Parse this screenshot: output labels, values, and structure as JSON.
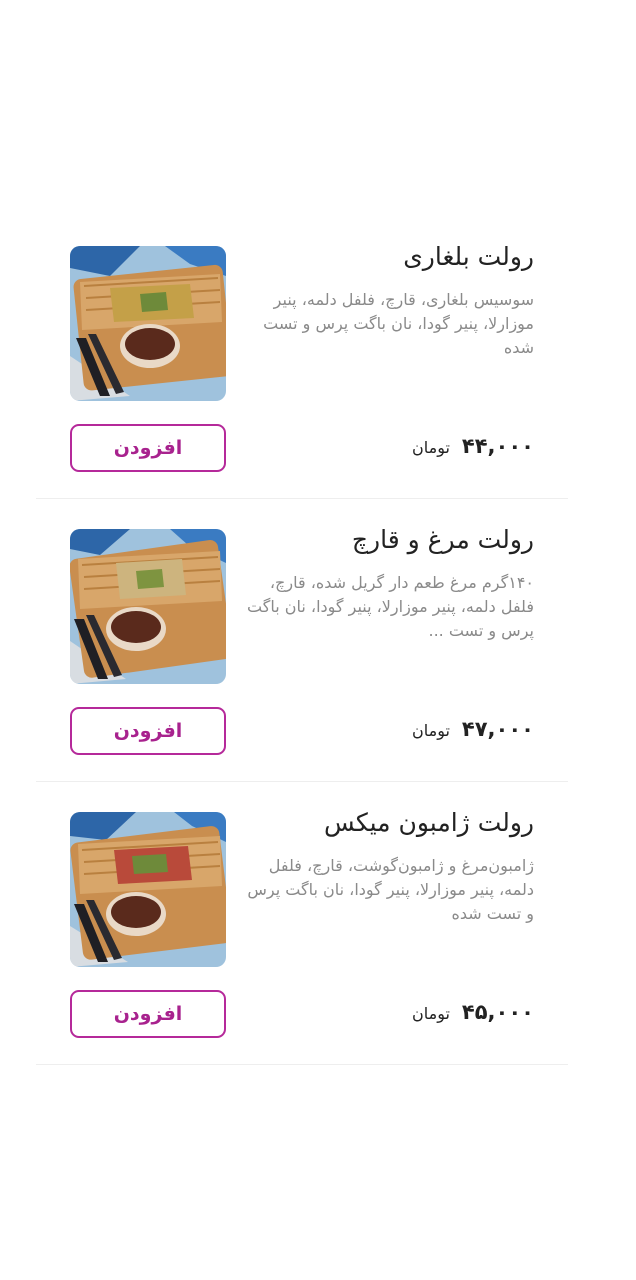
{
  "menu": {
    "items": [
      {
        "title": "رولت بلغاری",
        "description": "سوسیس بلغاری، قارچ، فلفل دلمه، پنیر موزارلا، پنیر گودا، نان باگت پرس و تست شده",
        "price": "۴۴,۰۰۰",
        "currency": "تومان",
        "add_label": "افزودن",
        "image_icon": "food-photo-roll"
      },
      {
        "title": "رولت مرغ و قارچ",
        "description": "۱۴۰گرم مرغ طعم دار گریل شده، قارچ، فلفل دلمه، پنیر موزارلا، پنیر گودا، نان باگت پرس و تست ...",
        "price": "۴۷,۰۰۰",
        "currency": "تومان",
        "add_label": "افزودن",
        "image_icon": "food-photo-roll"
      },
      {
        "title": "رولت ژامبون میکس",
        "description": "ژامبون‌مرغ و ژامبون‌گوشت، قارچ، فلفل دلمه، پنیر موزارلا، پنیر گودا، نان باگت پرس و تست شده",
        "price": "۴۵,۰۰۰",
        "currency": "تومان",
        "add_label": "افزودن",
        "image_icon": "food-photo-roll"
      }
    ]
  },
  "colors": {
    "accent": "#b5299a",
    "title": "#222222",
    "description": "#8a8a8a",
    "divider": "#eeeeee"
  }
}
